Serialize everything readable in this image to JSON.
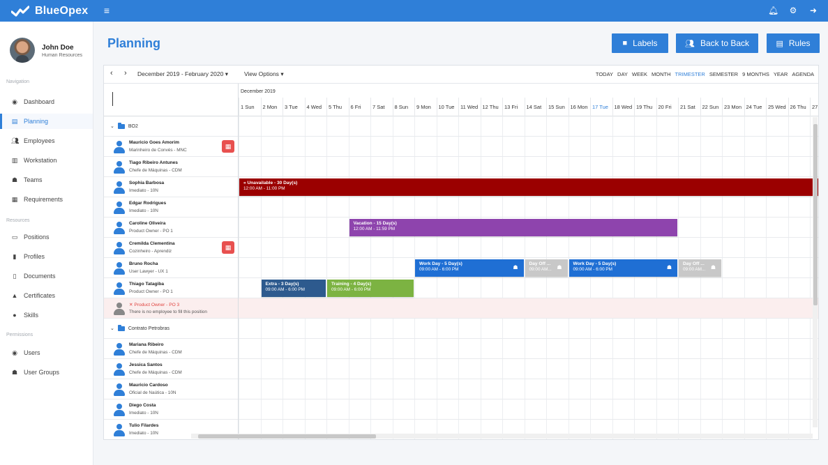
{
  "app": {
    "name": "BlueOpex"
  },
  "topbar": {
    "icons": [
      "bell-icon",
      "gear-icon",
      "logout-icon"
    ]
  },
  "user": {
    "name": "John Doe",
    "role": "Human Resources"
  },
  "nav": {
    "sections": [
      {
        "label": "Navigation",
        "items": [
          {
            "label": "Dashboard",
            "icon": "dashboard-icon"
          },
          {
            "label": "Planning",
            "icon": "calendar-icon",
            "active": true
          },
          {
            "label": "Employees",
            "icon": "users-icon"
          },
          {
            "label": "Workstation",
            "icon": "building-icon"
          },
          {
            "label": "Teams",
            "icon": "teams-icon"
          },
          {
            "label": "Requirements",
            "icon": "table-icon"
          }
        ]
      },
      {
        "label": "Resources",
        "items": [
          {
            "label": "Positions",
            "icon": "id-card-icon"
          },
          {
            "label": "Profiles",
            "icon": "books-icon"
          },
          {
            "label": "Documents",
            "icon": "file-icon"
          },
          {
            "label": "Certificates",
            "icon": "graduation-icon"
          },
          {
            "label": "Skills",
            "icon": "lightbulb-icon"
          }
        ]
      },
      {
        "label": "Permissions",
        "items": [
          {
            "label": "Users",
            "icon": "user-circle-icon"
          },
          {
            "label": "User Groups",
            "icon": "user-group-icon"
          }
        ]
      }
    ]
  },
  "page": {
    "title": "Planning"
  },
  "actions": {
    "labels": "Labels",
    "back_to_back": "Back to Back",
    "rules": "Rules"
  },
  "scheduler": {
    "range": "December 2019 - February 2020",
    "view_options": "View Options",
    "views": [
      "TODAY",
      "DAY",
      "WEEK",
      "MONTH",
      "TRIMESTER",
      "SEMESTER",
      "9 MONTHS",
      "YEAR",
      "AGENDA"
    ],
    "selected_view": "TRIMESTER",
    "month": "December 2019",
    "days": [
      "1 Sun",
      "2 Mon",
      "3 Tue",
      "4 Wed",
      "5 Thu",
      "6 Fri",
      "7 Sat",
      "8 Sun",
      "9 Mon",
      "10 Tue",
      "11 Wed",
      "12 Thu",
      "13 Fri",
      "14 Sat",
      "15 Sun",
      "16 Mon",
      "17 Tue",
      "18 Wed",
      "19 Thu",
      "20 Fri",
      "21 Sat",
      "22 Sun",
      "23 Mon",
      "24 Tue",
      "25 Wed",
      "26 Thu",
      "27"
    ],
    "today_index": 16
  },
  "rows": [
    {
      "type": "group",
      "label": "BO2"
    },
    {
      "type": "person",
      "name": "Mauricio Goes Amorim",
      "role": "Marinheiro de Convés - MNC",
      "calendar": true
    },
    {
      "type": "person",
      "name": "Tiago Ribeiro Antunes",
      "role": "Chefe de Máquinas - CDM"
    },
    {
      "type": "person",
      "name": "Sophia Barbosa",
      "role": "Imediato - 10N"
    },
    {
      "type": "person",
      "name": "Edgar Rodrigues",
      "role": "Imediato - 10N"
    },
    {
      "type": "person",
      "name": "Caroline Oliveira",
      "role": "Product Owner - PO 1"
    },
    {
      "type": "person",
      "name": "Cremilda Clementina",
      "role": "Cozinheiro - Aprendiz",
      "calendar": true
    },
    {
      "type": "person",
      "name": "Bruno Rocha",
      "role": "User Lawyer - UX 1"
    },
    {
      "type": "person",
      "name": "Thiago Tatagiba",
      "role": "Product Owner - PO 1"
    },
    {
      "type": "vacant",
      "name": "✕ Product Owner - PO 3",
      "role": "There is no employee to fill this position"
    },
    {
      "type": "group",
      "label": "Contrato Petrobras"
    },
    {
      "type": "person",
      "name": "Mariana Ribeiro",
      "role": "Chefe de Máquinas - CDM"
    },
    {
      "type": "person",
      "name": "Jessica Santos",
      "role": "Chefe de Máquinas - CDM"
    },
    {
      "type": "person",
      "name": "Mauricio Cardoso",
      "role": "Oficial de Naútica - 10N"
    },
    {
      "type": "person",
      "name": "Diego Costa",
      "role": "Imediato - 10N"
    },
    {
      "type": "person",
      "name": "Tulio Filardes",
      "role": "Imediato - 10N"
    }
  ],
  "events": [
    {
      "row": 3,
      "start": 0,
      "days": 27,
      "title": "Unavailable - 30 Day(s)",
      "time": "12:00 AM - 11:00 PM",
      "color": "#9b0000",
      "prefix": "«"
    },
    {
      "row": 5,
      "start": 5,
      "days": 15,
      "title": "Vacation - 15 Day(s)",
      "time": "12:00 AM - 11:59 PM",
      "color": "#8e44ad"
    },
    {
      "row": 7,
      "start": 8,
      "days": 5,
      "title": "Work Day - 5 Day(s)",
      "time": "09:00 AM - 6:00 PM",
      "color": "#1f6fd4",
      "icon": "group-icon"
    },
    {
      "row": 7,
      "start": 13,
      "days": 2,
      "title": "Day Off ...",
      "time": "09:00 AM...",
      "color": "#c8c8c8",
      "icon": "group-icon"
    },
    {
      "row": 7,
      "start": 15,
      "days": 5,
      "title": "Work Day - 5 Day(s)",
      "time": "09:00 AM - 6:00 PM",
      "color": "#1f6fd4",
      "icon": "group-icon"
    },
    {
      "row": 7,
      "start": 20,
      "days": 2,
      "title": "Day Off ...",
      "time": "09:00 AM...",
      "color": "#c8c8c8",
      "icon": "group-icon"
    },
    {
      "row": 8,
      "start": 1,
      "days": 3,
      "title": "Extra - 3 Day(s)",
      "time": "09:00 AM - 6:00 PM",
      "color": "#2d5a8e"
    },
    {
      "row": 8,
      "start": 4,
      "days": 4,
      "title": "Training - 4 Day(s)",
      "time": "09:00 AM - 6:00 PM",
      "color": "#7cb342"
    }
  ]
}
